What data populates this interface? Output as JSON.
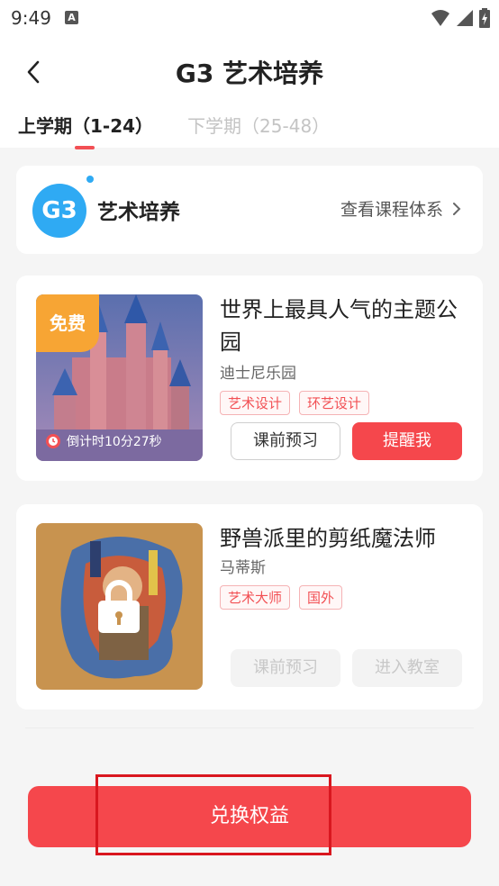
{
  "status_bar": {
    "time": "9:49"
  },
  "header": {
    "title": "G3 艺术培养",
    "tabs": [
      {
        "label": "上学期（1-24）",
        "active": true
      },
      {
        "label": "下学期（25-48）",
        "active": false
      }
    ]
  },
  "course": {
    "badge": "G3",
    "name": "艺术培养",
    "view_system": "查看课程体系"
  },
  "lessons": [
    {
      "free_badge": "免费",
      "countdown": "倒计时10分27秒",
      "title": "世界上最具人气的主题公园",
      "subtitle": "迪士尼乐园",
      "tags": [
        "艺术设计",
        "环艺设计"
      ],
      "buttons": [
        "课前预习",
        "提醒我"
      ],
      "locked": false
    },
    {
      "title": "野兽派里的剪纸魔法师",
      "subtitle": "马蒂斯",
      "tags": [
        "艺术大师",
        "国外"
      ],
      "buttons": [
        "课前预习",
        "进入教室"
      ],
      "locked": true
    }
  ],
  "footer": {
    "redeem_label": "兑换权益"
  },
  "colors": {
    "accent": "#f5474c",
    "badge_blue": "#2faaf3",
    "free_orange": "#f7a534"
  }
}
